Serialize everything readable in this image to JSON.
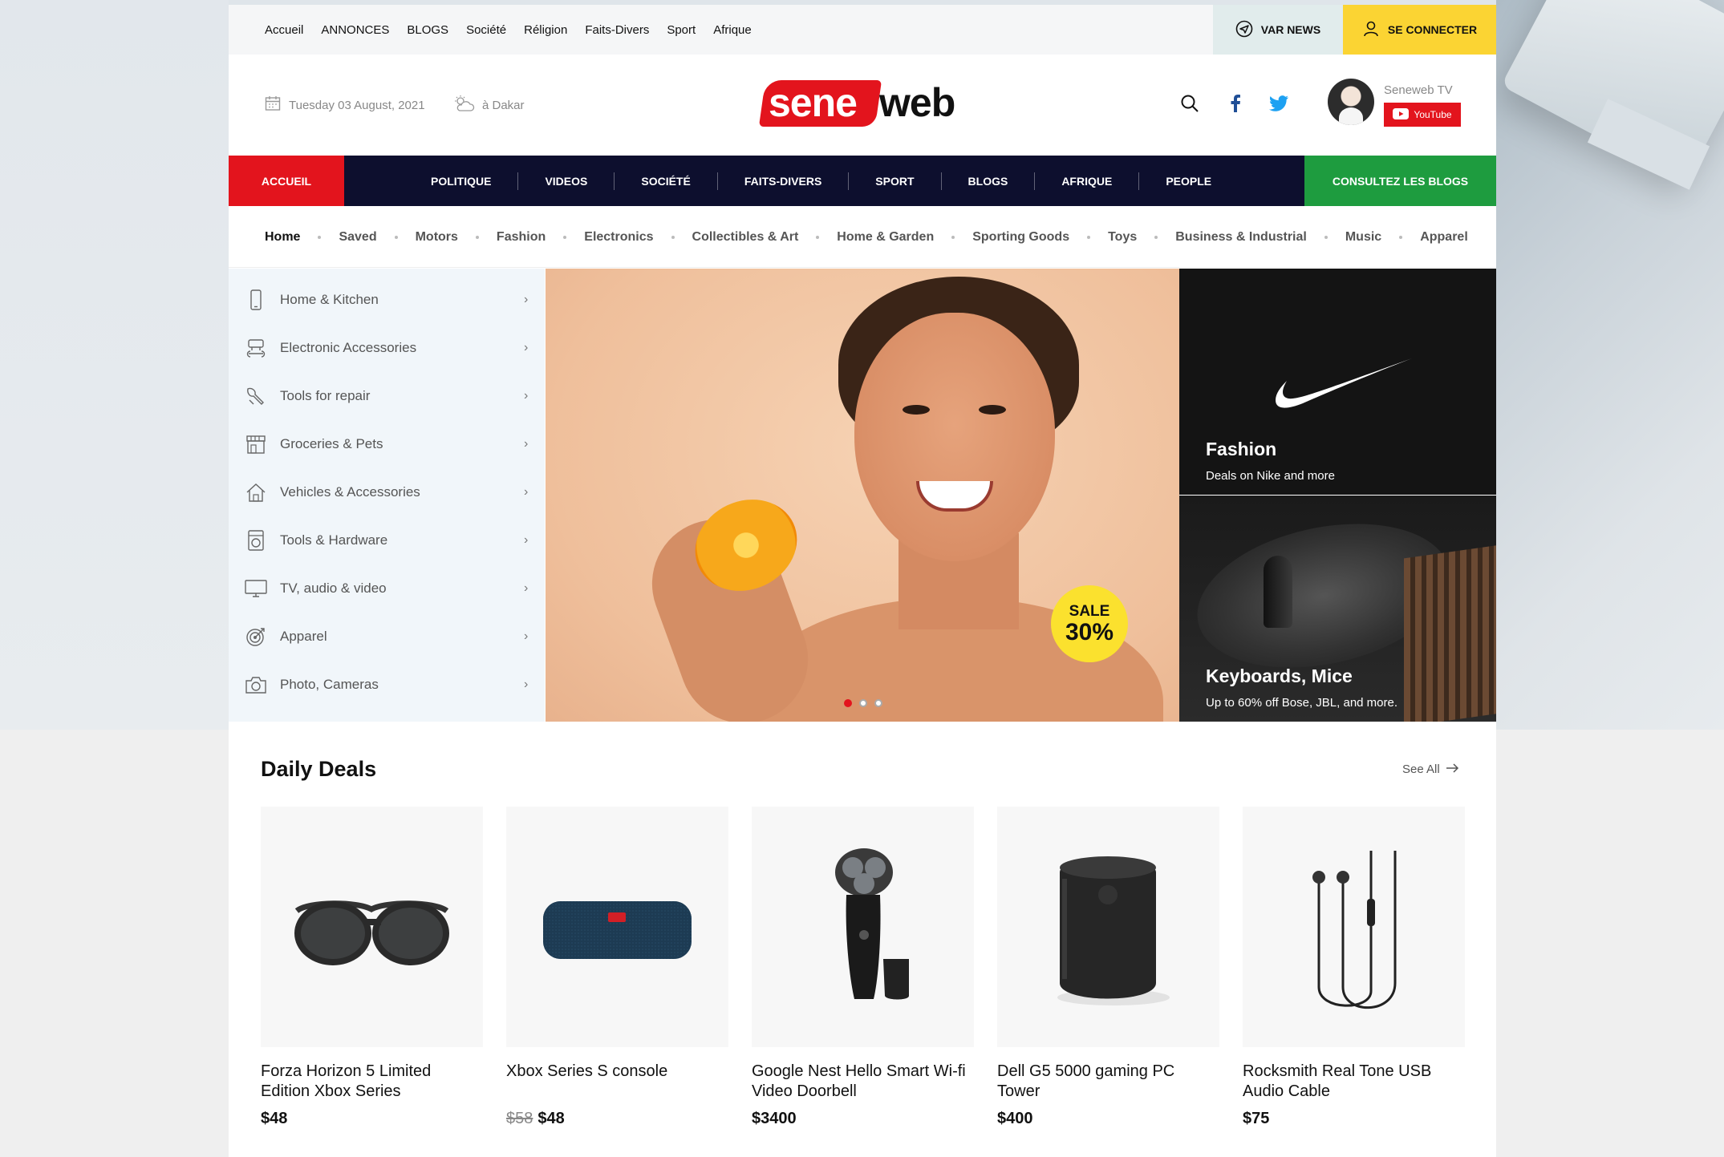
{
  "topbar": {
    "links": [
      "Accueil",
      "ANNONCES",
      "BLOGS",
      "Société",
      "Réligion",
      "Faits-Divers",
      "Sport",
      "Afrique"
    ],
    "var_news": "VAR NEWS",
    "connect": "SE CONNECTER"
  },
  "header": {
    "date": "Tuesday 03 August, 2021",
    "location": "à Dakar",
    "logo_left": "sene",
    "logo_right": "web",
    "tv_name": "Seneweb TV",
    "youtube_label": "YouTube"
  },
  "mainnav": {
    "home": "ACCUEIL",
    "items": [
      "POLITIQUE",
      "VIDEOS",
      "SOCIÉTÉ",
      "FAITS-DIVERS",
      "SPORT",
      "BLOGS",
      "AFRIQUE",
      "PEOPLE"
    ],
    "cta": "CONSULTEZ LES BLOGS"
  },
  "catbar": {
    "items": [
      "Home",
      "Saved",
      "Motors",
      "Fashion",
      "Electronics",
      "Collectibles & Art",
      "Home & Garden",
      "Sporting Goods",
      "Toys",
      "Business & Industrial",
      "Music",
      "Apparel"
    ]
  },
  "sidebar": {
    "items": [
      {
        "label": "Home & Kitchen",
        "icon": "phone-icon"
      },
      {
        "label": "Electronic Accessories",
        "icon": "accessories-icon"
      },
      {
        "label": "Tools for repair",
        "icon": "repair-icon"
      },
      {
        "label": "Groceries & Pets",
        "icon": "store-icon"
      },
      {
        "label": "Vehicles & Accessories",
        "icon": "house-icon"
      },
      {
        "label": "Tools & Hardware",
        "icon": "washer-icon"
      },
      {
        "label": "TV, audio & video",
        "icon": "monitor-icon"
      },
      {
        "label": "Apparel",
        "icon": "target-icon"
      },
      {
        "label": "Photo, Cameras",
        "icon": "camera-icon"
      }
    ]
  },
  "hero": {
    "sale_word": "SALE",
    "sale_pct": "30%",
    "slides_count": 3,
    "active_slide": 1
  },
  "promos": [
    {
      "title": "Fashion",
      "subtitle": "Deals on Nike and more"
    },
    {
      "title": "Keyboards, Mice",
      "subtitle": "Up to 60% off Bose, JBL, and more."
    }
  ],
  "deals": {
    "title": "Daily Deals",
    "see_all": "See All",
    "items": [
      {
        "name": "Forza Horizon 5 Limited Edition Xbox Series",
        "old_price": "",
        "price": "$48",
        "image": "sunglasses"
      },
      {
        "name": "Xbox Series S console",
        "old_price": "$58",
        "price": "$48",
        "image": "speaker-jbl"
      },
      {
        "name": "Google Nest Hello Smart Wi-fi Video Doorbell",
        "old_price": "",
        "price": "$3400",
        "image": "shaver"
      },
      {
        "name": "Dell G5 5000 gaming PC Tower",
        "old_price": "",
        "price": "$400",
        "image": "smart-speaker"
      },
      {
        "name": "Rocksmith Real Tone USB Audio Cable",
        "old_price": "",
        "price": "$75",
        "image": "earphones"
      }
    ]
  },
  "colors": {
    "red": "#e3141d",
    "navy": "#0d0f2e",
    "green": "#1e9c3f",
    "yellow": "#fbd433",
    "sidebar_bg": "#f1f6fa"
  }
}
